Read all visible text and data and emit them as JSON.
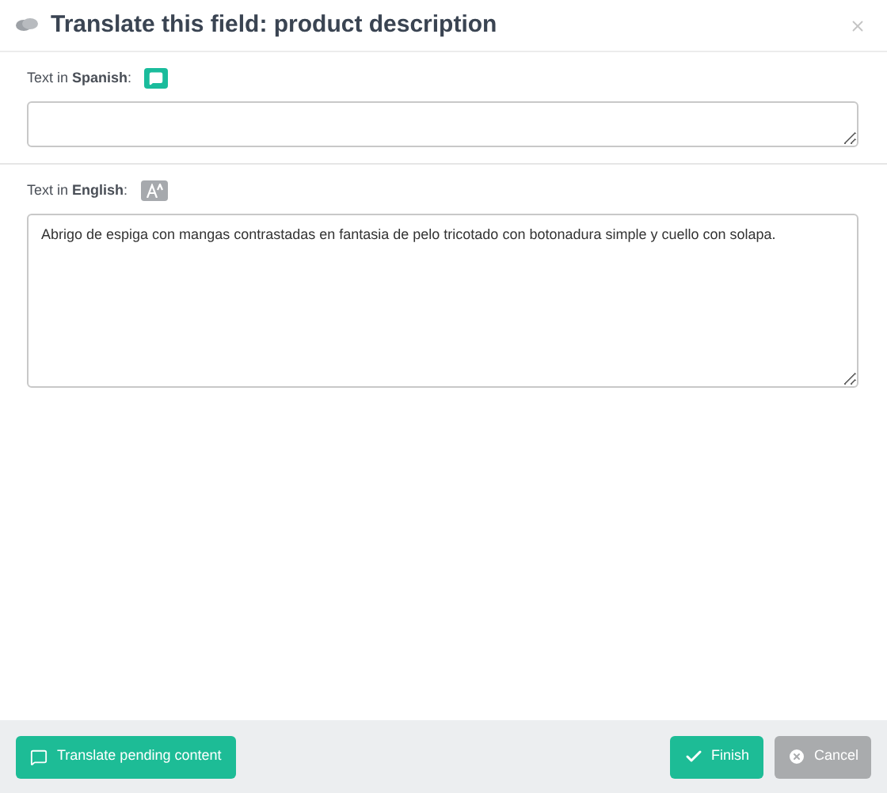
{
  "dialog": {
    "title": "Translate this field: product description"
  },
  "fields": [
    {
      "label": "Text in **Spanish**:",
      "kind": "target"
    },
    {
      "label": "Text in **English**:",
      "kind": "source",
      "value": "Abrigo de espiga con mangas contrastadas en fantasia de pelo tricotado con botonadura simple y cuello con solapa."
    }
  ],
  "footer": {
    "translate_button": "Translate pending content",
    "finish_button": "Finish",
    "cancel_button": "Cancel"
  }
}
